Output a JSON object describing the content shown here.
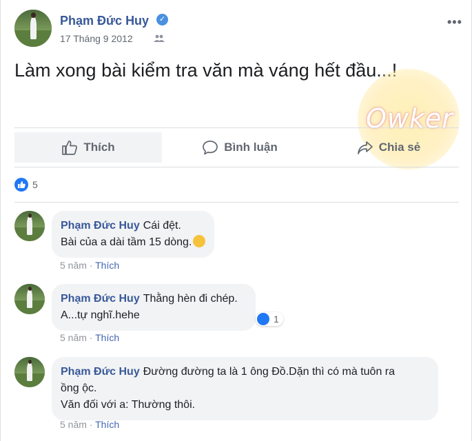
{
  "post": {
    "author": "Phạm Đức Huy",
    "date": "17 Tháng 9 2012",
    "text": "Làm xong bài kiểm tra văn mà váng hết đầu...!",
    "watermark": "Owker"
  },
  "actions": {
    "like": "Thích",
    "comment": "Bình luận",
    "share": "Chia sẻ"
  },
  "reactions": {
    "count": "5"
  },
  "comments": [
    {
      "name": "Phạm Đức Huy",
      "line1": "Cái đệt.",
      "line2": "Bài của a dài tầm 15 dòng.",
      "time": "5 năm",
      "like": "Thích"
    },
    {
      "name": "Phạm Đức Huy",
      "line1": "Thằng hèn đi chép.",
      "line2": "A...tự nghĩ.hehe",
      "time": "5 năm",
      "like": "Thích",
      "reactions": "1"
    },
    {
      "name": "Phạm Đức Huy",
      "line1": "Đường đường ta là 1 ông Đồ.Dặn thì có mà tuôn ra",
      "line2": "ồng ộc.",
      "line3": "Văn đối với a: Thường thôi.",
      "time": "5 năm",
      "like": "Thích"
    }
  ],
  "colors": {
    "link": "#385898",
    "like_blue": "#2078f4",
    "meta_gray": "#90949c"
  }
}
